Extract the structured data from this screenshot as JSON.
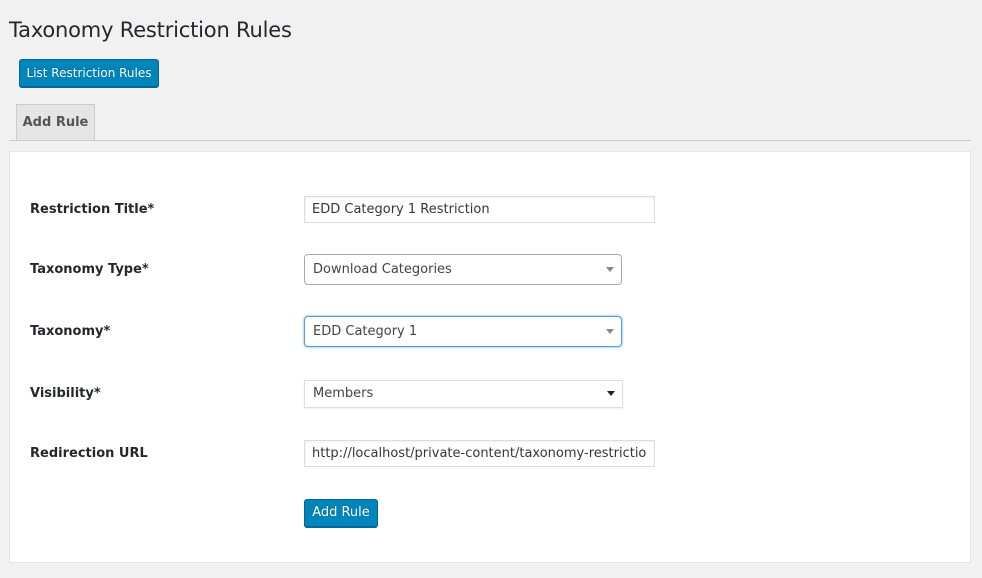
{
  "page": {
    "title": "Taxonomy Restriction Rules",
    "list_button_label": "List Restriction Rules"
  },
  "tabs": [
    {
      "label": "Add Rule",
      "active": true
    }
  ],
  "form": {
    "restriction_title": {
      "label": "Restriction Title*",
      "value": "EDD Category 1 Restriction"
    },
    "taxonomy_type": {
      "label": "Taxonomy Type*",
      "selected": "Download Categories"
    },
    "taxonomy": {
      "label": "Taxonomy*",
      "selected": "EDD Category 1"
    },
    "visibility": {
      "label": "Visibility*",
      "selected": "Members"
    },
    "redirection_url": {
      "label": "Redirection URL",
      "value": "http://localhost/private-content/taxonomy-restriction"
    },
    "submit_label": "Add Rule"
  },
  "colors": {
    "primary": "#0085ba",
    "background": "#f1f1f1",
    "panel": "#ffffff"
  }
}
